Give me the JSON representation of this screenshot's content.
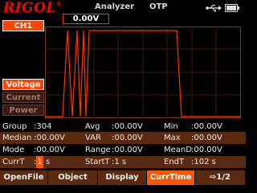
{
  "header": {
    "brand": "RIGOL",
    "mode": "Analyzer",
    "function": "OTP",
    "icons": [
      "usb-icon",
      "battery-icon"
    ]
  },
  "channel": {
    "label": "CH1",
    "trigger_value": "0.00V"
  },
  "side_tabs": [
    {
      "label": "Voltage",
      "active": true
    },
    {
      "label": "Current",
      "active": false
    },
    {
      "label": "Power",
      "active": false
    }
  ],
  "stats": {
    "group_label": "Group",
    "group_value": ":304",
    "avg_label": "Avg",
    "avg_value": ":00.00V",
    "min_label": "Min",
    "min_value": ":00.00V",
    "median_label": "Median",
    "median_value": ":00.00V",
    "var_label": "VAR",
    "var_value": ":00.00V",
    "max_label": "Max",
    "max_value": ":00.00V",
    "mode_label": "Mode",
    "mode_value": ":00.00V",
    "range_label": "Range",
    "range_value": ":00.00V",
    "meand_label": "MeanD",
    "meand_value": ":00.00V",
    "currt_label": "CurrT",
    "currt_colon": ":",
    "currt_value": "1",
    "currt_unit": "s",
    "startt_label": "StartT",
    "startt_value": ":1 s",
    "endt_label": "EndT",
    "endt_value": ":102 s"
  },
  "menu": {
    "openfile": "OpenFile",
    "object": "Object",
    "display": "Display",
    "currtime": "CurrTime",
    "page": "⇨1/2"
  },
  "colors": {
    "accent": "#ff4400",
    "trace": "#ff3300",
    "row_alt": "#5a2a10",
    "grid": "#7a3a20"
  }
}
